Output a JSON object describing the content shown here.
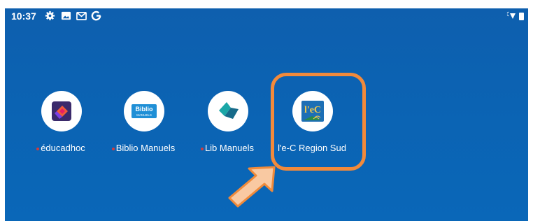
{
  "status_bar": {
    "time": "10:37",
    "left_icons": [
      "gear-icon",
      "image-icon",
      "gmail-icon",
      "google-g-icon"
    ],
    "right_icons": [
      "wifi-icon",
      "battery-icon"
    ]
  },
  "apps": [
    {
      "label": "éducadhoc",
      "icon": "educadhoc-logo-icon"
    },
    {
      "label": "Biblio Manuels",
      "icon": "biblio-manuels-logo-icon",
      "logo_text": "Biblio",
      "logo_subtext": "MANUELS"
    },
    {
      "label": "Lib Manuels",
      "icon": "lib-manuels-logo-icon"
    },
    {
      "label": "l'e-C Region Sud",
      "icon": "lec-region-sud-logo-icon",
      "logo_text": "l'eC"
    }
  ],
  "colors": {
    "background": "#0b63b3",
    "highlight": "#f28a3b",
    "arrow": "#f9c9a2"
  }
}
